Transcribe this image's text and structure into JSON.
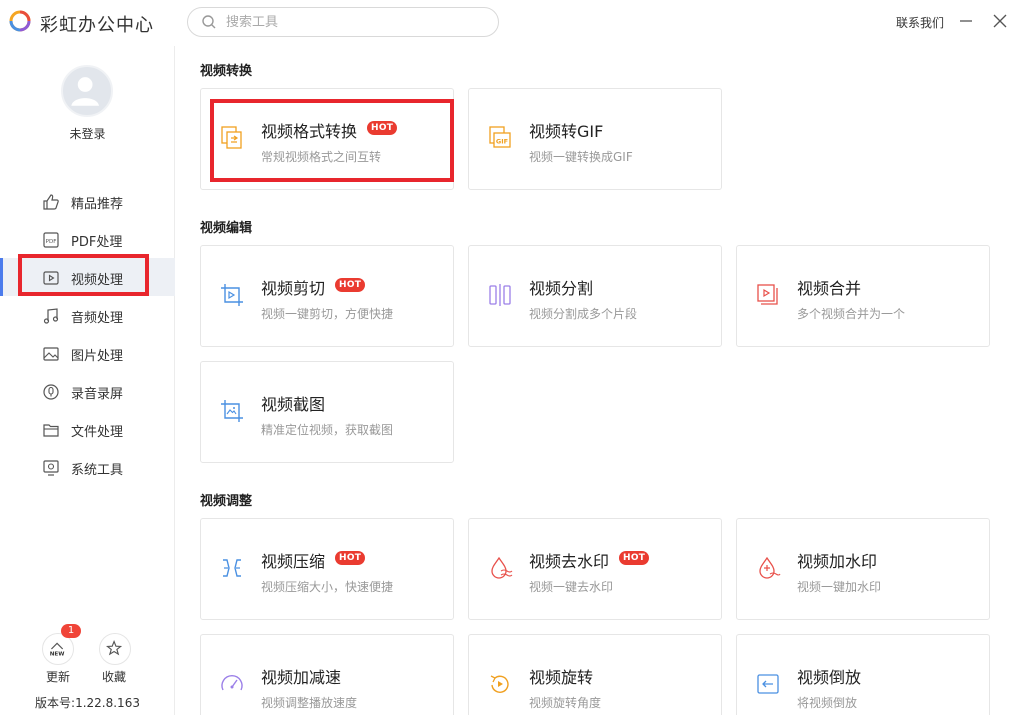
{
  "app": {
    "title": "彩虹办公中心",
    "contact": "联系我们"
  },
  "search": {
    "placeholder": "搜索工具"
  },
  "user": {
    "login_label": "未登录"
  },
  "sidebar": {
    "items": [
      {
        "label": "精品推荐",
        "icon": "thumbs-up-icon"
      },
      {
        "label": "PDF处理",
        "icon": "pdf-icon"
      },
      {
        "label": "视频处理",
        "icon": "video-icon",
        "active": true
      },
      {
        "label": "音频处理",
        "icon": "music-icon"
      },
      {
        "label": "图片处理",
        "icon": "image-icon"
      },
      {
        "label": "录音录屏",
        "icon": "record-icon"
      },
      {
        "label": "文件处理",
        "icon": "folder-icon"
      },
      {
        "label": "系统工具",
        "icon": "system-icon"
      }
    ],
    "update_label": "更新",
    "update_badge": "1",
    "update_icon_text": "NEW",
    "favorite_label": "收藏",
    "version": "版本号:1.22.8.163"
  },
  "sections": [
    {
      "title": "视频转换",
      "cards": [
        {
          "title": "视频格式转换",
          "desc": "常规视频格式之间互转",
          "hot": true,
          "icon": "format-convert-icon",
          "color": "#f0a020"
        },
        {
          "title": "视频转GIF",
          "desc": "视频一键转换成GIF",
          "hot": false,
          "icon": "gif-icon",
          "color": "#f0a020",
          "icon_text": "GIF"
        }
      ]
    },
    {
      "title": "视频编辑",
      "cards": [
        {
          "title": "视频剪切",
          "desc": "视频一键剪切，方便快捷",
          "hot": true,
          "icon": "crop-icon",
          "color": "#4a90e2"
        },
        {
          "title": "视频分割",
          "desc": "视频分割成多个片段",
          "hot": false,
          "icon": "split-icon",
          "color": "#9b7fe8"
        },
        {
          "title": "视频合并",
          "desc": "多个视频合并为一个",
          "hot": false,
          "icon": "merge-icon",
          "color": "#e8504a"
        },
        {
          "title": "视频截图",
          "desc": "精准定位视频，获取截图",
          "hot": false,
          "icon": "screenshot-icon",
          "color": "#4a90e2"
        }
      ]
    },
    {
      "title": "视频调整",
      "cards": [
        {
          "title": "视频压缩",
          "desc": "视频压缩大小，快速便捷",
          "hot": true,
          "icon": "compress-icon",
          "color": "#4a90e2"
        },
        {
          "title": "视频去水印",
          "desc": "视频一键去水印",
          "hot": true,
          "icon": "remove-watermark-icon",
          "color": "#e8504a"
        },
        {
          "title": "视频加水印",
          "desc": "视频一键加水印",
          "hot": false,
          "icon": "add-watermark-icon",
          "color": "#e8504a"
        },
        {
          "title": "视频加减速",
          "desc": "视频调整播放速度",
          "hot": false,
          "icon": "speed-icon",
          "color": "#9b7fe8"
        },
        {
          "title": "视频旋转",
          "desc": "视频旋转角度",
          "hot": false,
          "icon": "rotate-icon",
          "color": "#f0a020"
        },
        {
          "title": "视频倒放",
          "desc": "将视频倒放",
          "hot": false,
          "icon": "reverse-icon",
          "color": "#4a90e2"
        }
      ]
    }
  ],
  "hot_label": "HOT"
}
